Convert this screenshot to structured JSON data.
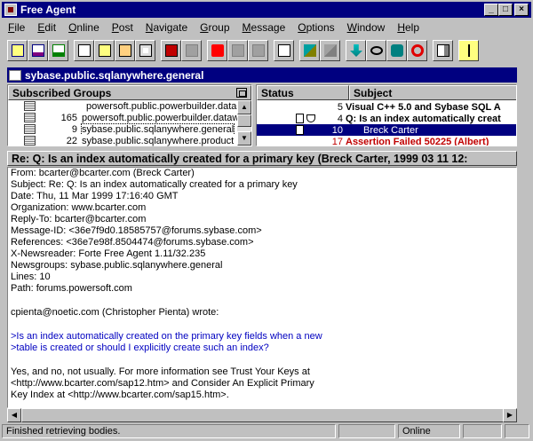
{
  "window": {
    "title": "Free Agent"
  },
  "menu": [
    "File",
    "Edit",
    "Online",
    "Post",
    "Navigate",
    "Group",
    "Message",
    "Options",
    "Window",
    "Help"
  ],
  "toolbar_icons": [
    "get-headers-icon",
    "get-bodies-icon",
    "get-messages-icon",
    "new-post-icon",
    "reply-icon",
    "post-reply-icon",
    "reply-email-icon",
    "forward-icon",
    "delete-icon",
    "go-online-icon",
    "go-back-icon",
    "print-icon",
    "save-icon",
    "open-browser-icon",
    "keep-icon",
    "mark-read-icon",
    "skip-icon",
    "watch-icon",
    "find-icon",
    "lock-icon",
    "cancel-icon",
    "meter-icon",
    "pointer-icon"
  ],
  "folder": {
    "title": "sybase.public.sqlanywhere.general"
  },
  "groups_pane": {
    "header": "Subscribed Groups",
    "rows": [
      {
        "count": "",
        "name": "powersoft.public.powerbuilder.datab"
      },
      {
        "count": "165",
        "name": "powersoft.public.powerbuilder.dataw"
      },
      {
        "count": "9",
        "name": "sybase.public.sqlanywhere.general"
      },
      {
        "count": "22",
        "name": "sybase.public.sqlanywhere.product"
      }
    ]
  },
  "subjects_pane": {
    "status_header": "Status",
    "subject_header": "Subject",
    "rows": [
      {
        "num": "5",
        "text": "Visual C++ 5.0 and Sybase SQL A"
      },
      {
        "num": "4",
        "text": "Q: Is an index automatically creat"
      },
      {
        "num": "10",
        "text": "Breck Carter"
      },
      {
        "num": "17",
        "text": "Assertion Failed 50225  (Albert)"
      }
    ]
  },
  "article": {
    "title": "Re: Q: Is an index automatically created for a primary key (Breck Carter, 1999 03 11 12:",
    "lines": [
      "From: bcarter@bcarter.com (Breck Carter)",
      "Subject: Re: Q: Is an index automatically created for a primary key",
      "Date: Thu, 11 Mar 1999 17:16:40 GMT",
      "Organization: www.bcarter.com",
      "Reply-To: bcarter@bcarter.com",
      "Message-ID: <36e7f9d0.18585757@forums.sybase.com>",
      "References: <36e7e98f.8504474@forums.sybase.com>",
      "X-Newsreader: Forte Free Agent 1.11/32.235",
      "Newsgroups: sybase.public.sqlanywhere.general",
      "Lines: 10",
      "Path: forums.powersoft.com"
    ],
    "intro": "cpienta@noetic.com (Christopher Pienta) wrote:",
    "quote": [
      ">Is an index automatically created on the primary key fields when a new",
      ">table is created or should I explicitly create such an index?"
    ],
    "reply": [
      "Yes, and no, not usually. For more information see Trust Your Keys at",
      "<http://www.bcarter.com/sap12.htm> and Consider An Explicit Primary",
      "Key Index at <http://www.bcarter.com/sap15.htm>."
    ]
  },
  "status": {
    "message": "Finished retrieving bodies.",
    "mode": "Online"
  }
}
